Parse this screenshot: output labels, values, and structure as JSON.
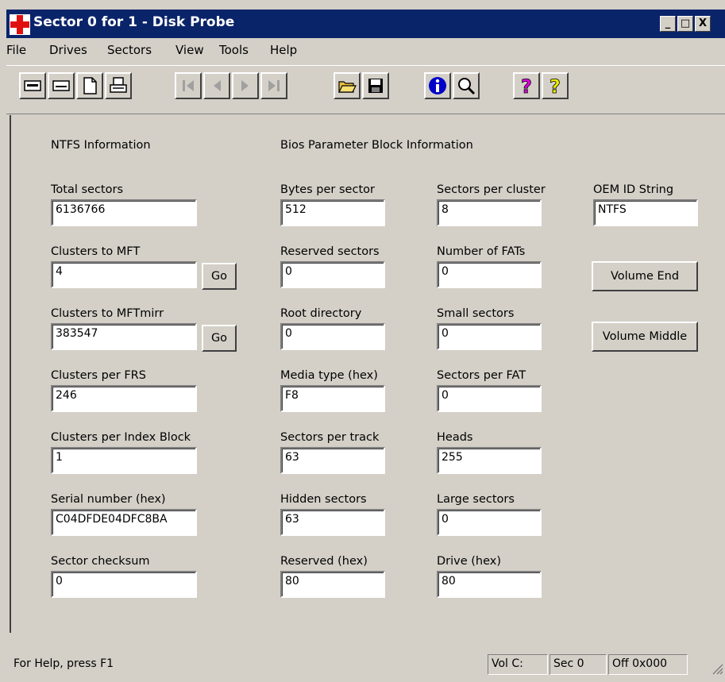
{
  "window": {
    "title": "Sector 0 for 1 - Disk Probe"
  },
  "caption_buttons": {
    "minimize": "_",
    "maximize": "□",
    "close": "X"
  },
  "menu": [
    "File",
    "Drives",
    "Sectors",
    "View",
    "Tools",
    "Help"
  ],
  "toolbar": {
    "buttons": [
      "logical-volume-icon",
      "physical-drive-icon",
      "new-page-icon",
      "print-icon",
      "first-sector-icon",
      "previous-sector-icon",
      "next-sector-icon",
      "last-sector-icon",
      "open-folder-icon",
      "save-icon",
      "info-icon",
      "search-icon",
      "help-icon",
      "context-help-icon"
    ]
  },
  "ntfs": {
    "heading": "NTFS Information",
    "total_sectors_label": "Total sectors",
    "total_sectors": "6136766",
    "clusters_mft_label": "Clusters to MFT",
    "clusters_mft": "4",
    "clusters_mftmirr_label": "Clusters to MFTmirr",
    "clusters_mftmirr": "383547",
    "clusters_frs_label": "Clusters per FRS",
    "clusters_frs": "246",
    "clusters_index_label": "Clusters per Index Block",
    "clusters_index": "1",
    "serial_label": "Serial number (hex)",
    "serial": "C04DFDE04DFC8BA",
    "checksum_label": "Sector checksum",
    "checksum": "0",
    "go_label": "Go"
  },
  "bpb": {
    "heading": "Bios Parameter Block Information",
    "bytes_per_sector_label": "Bytes per sector",
    "bytes_per_sector": "512",
    "reserved_sectors_label": "Reserved sectors",
    "reserved_sectors": "0",
    "root_directory_label": "Root directory",
    "root_directory": "0",
    "media_type_label": "Media type (hex)",
    "media_type": "F8",
    "sectors_per_track_label": "Sectors per track",
    "sectors_per_track": "63",
    "hidden_sectors_label": "Hidden sectors",
    "hidden_sectors": "63",
    "reserved_hex_label": "Reserved (hex)",
    "reserved_hex": "80",
    "sectors_per_cluster_label": "Sectors per cluster",
    "sectors_per_cluster": "8",
    "number_fats_label": "Number of FATs",
    "number_fats": "0",
    "small_sectors_label": "Small sectors",
    "small_sectors": "0",
    "sectors_per_fat_label": "Sectors per FAT",
    "sectors_per_fat": "0",
    "heads_label": "Heads",
    "heads": "255",
    "large_sectors_label": "Large sectors",
    "large_sectors": "0",
    "drive_hex_label": "Drive (hex)",
    "drive_hex": "80"
  },
  "oem": {
    "label": "OEM ID String",
    "value": "NTFS"
  },
  "buttons": {
    "volume_end": "Volume End",
    "volume_middle": "Volume Middle"
  },
  "status": {
    "help": "For Help, press F1",
    "vol": "Vol  C:",
    "sec": "Sec 0",
    "off": "Off 0x000"
  }
}
